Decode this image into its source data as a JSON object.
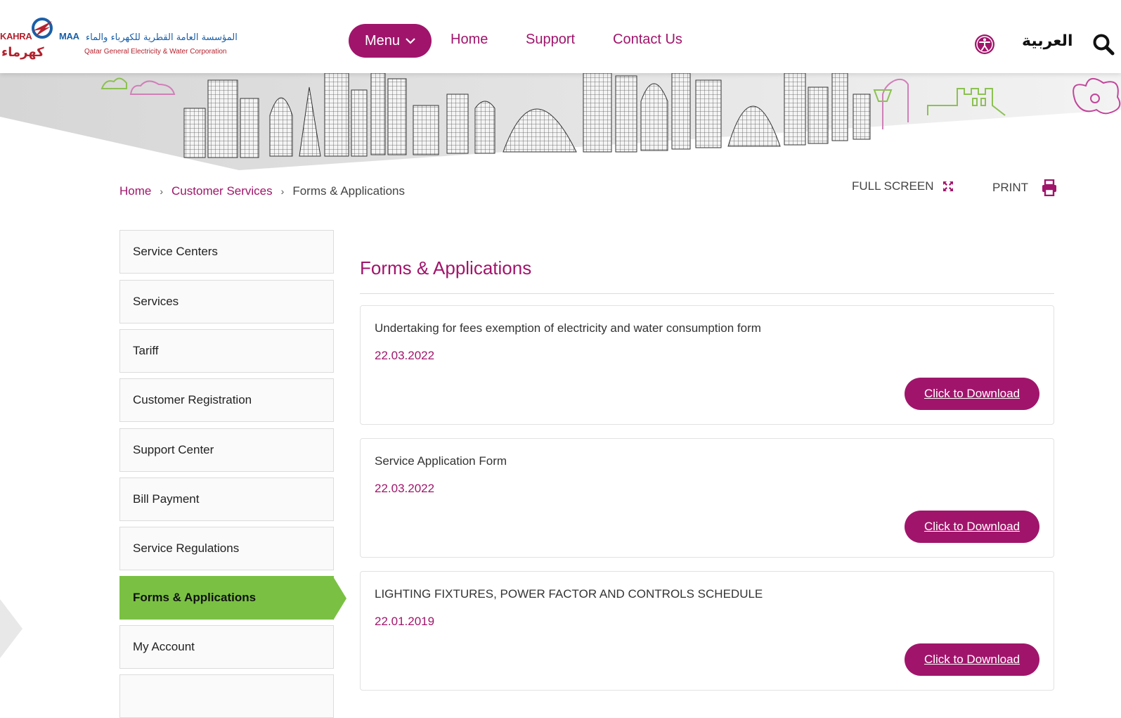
{
  "header": {
    "logo": {
      "latin_left": "KAHRA",
      "latin_right": "MAA",
      "arabic_short": "كهرماء",
      "arabic_full": "المؤسسة العامة القطرية للكهرباء والماء",
      "english_full": "Qatar General Electricity & Water Corporation"
    },
    "menu_label": "Menu",
    "nav": [
      "Home",
      "Support",
      "Contact Us"
    ],
    "language_label": "العربية",
    "icons": {
      "accessibility": "accessibility-icon",
      "search": "search-icon",
      "menu": "chevron-down-icon"
    }
  },
  "breadcrumb": {
    "items": [
      "Home",
      "Customer Services"
    ],
    "current": "Forms & Applications"
  },
  "tools": {
    "fullscreen_label": "FULL SCREEN",
    "print_label": "PRINT"
  },
  "sidebar": {
    "items": [
      {
        "label": "Service Centers"
      },
      {
        "label": "Services"
      },
      {
        "label": "Tariff"
      },
      {
        "label": "Customer Registration"
      },
      {
        "label": "Support Center"
      },
      {
        "label": "Bill Payment"
      },
      {
        "label": "Service Regulations"
      },
      {
        "label": "Forms & Applications",
        "active": true
      },
      {
        "label": "My Account"
      },
      {
        "label": ""
      }
    ]
  },
  "main": {
    "title": "Forms & Applications",
    "forms": [
      {
        "title": "Undertaking for fees exemption of electricity and water consumption form",
        "date": "22.03.2022",
        "button": "Click to Download"
      },
      {
        "title": "Service Application Form",
        "date": "22.03.2022",
        "button": "Click to Download"
      },
      {
        "title": "LIGHTING FIXTURES, POWER FACTOR AND CONTROLS SCHEDULE",
        "date": "22.01.2019",
        "button": "Click to Download"
      }
    ]
  },
  "colors": {
    "brand": "#a0156b",
    "active": "#7ac143",
    "logo_red": "#b3222e",
    "logo_blue": "#1a5fa8"
  }
}
